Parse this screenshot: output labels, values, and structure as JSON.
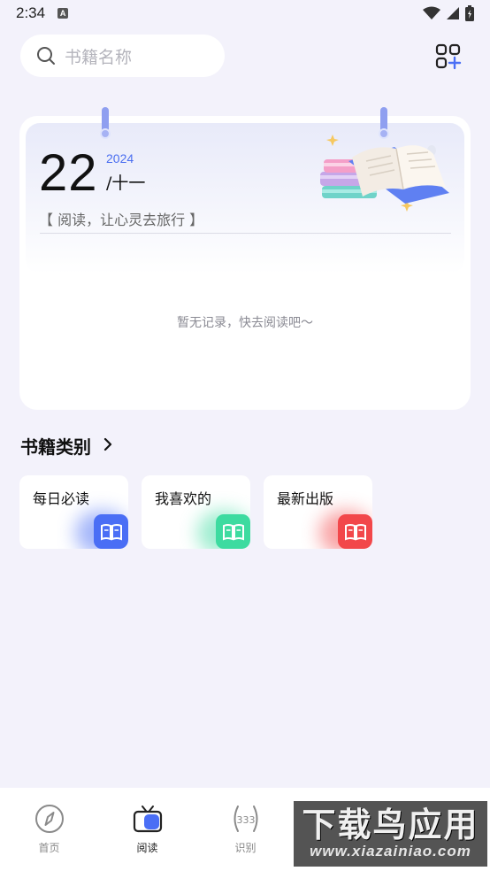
{
  "status_bar": {
    "time": "2:34",
    "notif_letter": "A"
  },
  "search": {
    "placeholder": "书籍名称"
  },
  "calendar": {
    "day": "22",
    "year": "2024",
    "month": "/十一",
    "motto": "【 阅读，让心灵去旅行 】",
    "empty_message": "暂无记录，快去阅读吧～"
  },
  "categories_section": {
    "title": "书籍类别",
    "items": [
      {
        "label": "每日必读",
        "color": "#4a6ef5"
      },
      {
        "label": "我喜欢的",
        "color": "#3ddba0"
      },
      {
        "label": "最新出版",
        "color": "#f2474a"
      }
    ]
  },
  "bottom_nav": {
    "items": [
      {
        "label": "首页",
        "icon": "compass-icon"
      },
      {
        "label": "阅读",
        "icon": "book-tv-icon",
        "active": true
      },
      {
        "label": "识别",
        "icon": "scan-icon"
      }
    ]
  },
  "watermark": {
    "main": "下载鸟应用",
    "url": "www.xiazainiao.com"
  },
  "colors": {
    "accent": "#4a6ef5",
    "background": "#f3f2fb"
  }
}
